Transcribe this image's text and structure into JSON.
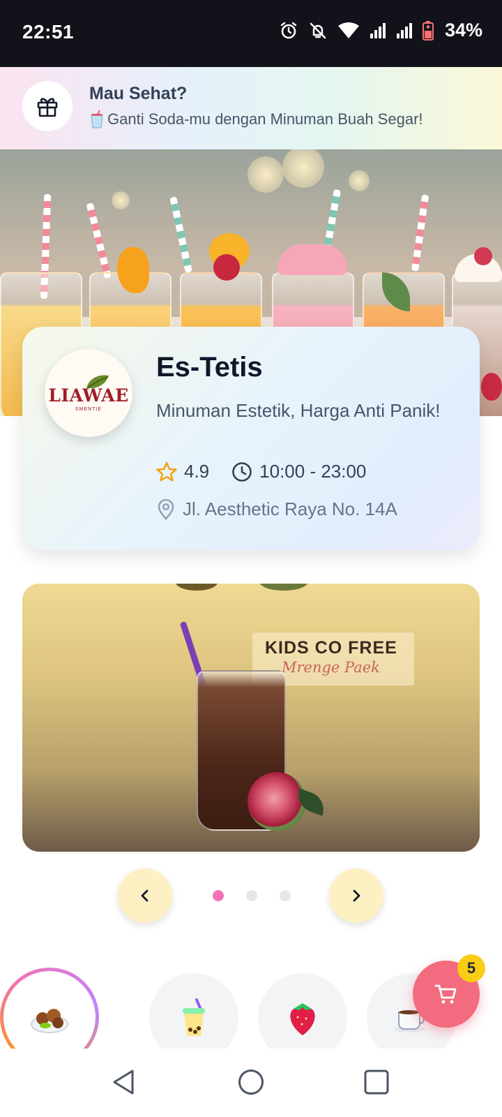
{
  "status_bar": {
    "time": "22:51",
    "battery_percent": "34%",
    "icons": [
      "alarm-icon",
      "bell-off-icon",
      "wifi-icon",
      "signal-icon",
      "signal-icon",
      "battery-icon"
    ]
  },
  "promo": {
    "icon": "gift-icon",
    "title": "Mau Sehat?",
    "subtitle": "Ganti Soda-mu dengan Minuman Buah Segar!"
  },
  "store": {
    "logo_text": "LIAWAE",
    "logo_subtext": "SMENTIE",
    "name": "Es-Tetis",
    "tagline": "Minuman Estetik, Harga Anti Panik!",
    "rating": "4.9",
    "hours": "10:00 - 23:00",
    "address": "Jl. Aesthetic Raya No. 14A"
  },
  "carousel": {
    "slide_title": "KIDS CO FREE",
    "slide_subtitle": "Mrenge Paek",
    "total_slides": 3,
    "active_index": 0,
    "active_color": "#f472b6"
  },
  "categories": [
    {
      "icon": "fried-food-icon",
      "active": true
    },
    {
      "icon": "bubble-tea-icon",
      "active": false
    },
    {
      "icon": "strawberry-icon",
      "active": false
    },
    {
      "icon": "coffee-icon",
      "active": false
    }
  ],
  "cart": {
    "icon": "cart-icon",
    "count": "5",
    "color": "#f26b7e"
  },
  "system_nav": [
    "back-icon",
    "home-icon",
    "recents-icon"
  ]
}
